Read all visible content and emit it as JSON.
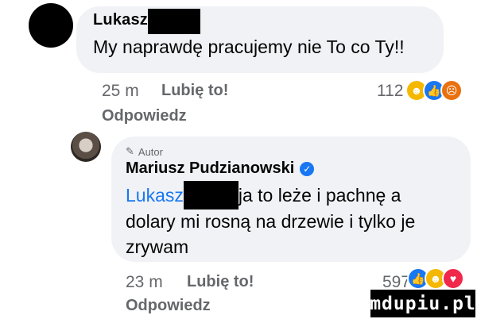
{
  "comment1": {
    "author": "Lukasz",
    "text": "My naprawdę pracujemy nie To co Ty!!",
    "time": "25 m",
    "like_label": "Lubię to!",
    "reaction_count": "112",
    "reply_label": "Odpowiedz",
    "reactions": [
      "haha-icon",
      "like-icon",
      "angry-icon"
    ]
  },
  "comment2": {
    "badge": "Autor",
    "author": "Mariusz Pudzianowski",
    "mention": "Lukasz",
    "text_line1": "ja to leże  i pachnę  a",
    "text_line2": "dolary mi rosną  na drzewie i tylko je",
    "text_line3": "zrywam",
    "time": "23 m",
    "like_label": "Lubię to!",
    "reaction_count": "597",
    "reply_label": "Odpowiedz",
    "reactions": [
      "like-icon",
      "haha-icon",
      "love-icon"
    ]
  },
  "watermark": "mdupiu.pl",
  "colors": {
    "bubble": "#f0f2f5",
    "link": "#1877f2",
    "meta": "#65676b"
  }
}
